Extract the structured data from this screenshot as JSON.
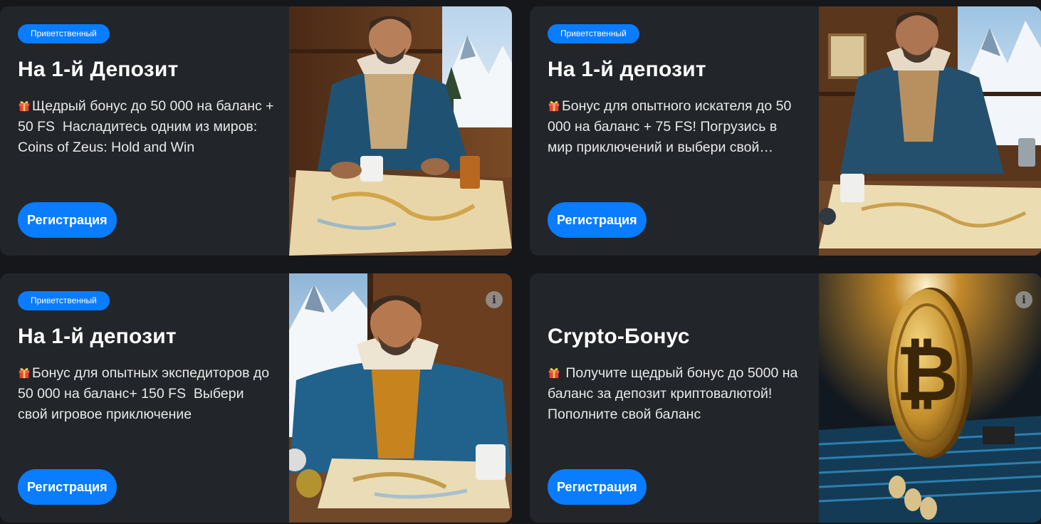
{
  "cards": [
    {
      "badge": "Приветственный",
      "title": "На 1-й Депозит",
      "description": "Щедрый бонус до 50 000 на баланс + 50 FS  Насладитесь одним из миров: Coins of Zeus: Hold and Win",
      "cta": "Регистрация",
      "image": "explorer-map-cabin",
      "has_info": false
    },
    {
      "badge": "Приветственный",
      "title": "На 1-й депозит",
      "description": "Бонус для опытного искателя до 50 000 на баланс + 75 FS! Погрузись в мир приключений и выбери свой игровой мир",
      "cta": "Регистрация",
      "image": "explorer-map-window",
      "has_info": false
    },
    {
      "badge": "Приветственный",
      "title": "На 1-й депозит",
      "description": "Бонус для опытных экспедиторов до 50 000 на баланс+ 150 FS  Выбери свой игровое приключение",
      "cta": "Регистрация",
      "image": "explorer-map-mountains",
      "has_info": true
    },
    {
      "badge": "",
      "title": "Crypto-Бонус",
      "description": " Получите щедрый бонус до 5000 на баланс за депозит криптовалютой! Пополните свой баланс",
      "cta": "Регистрация",
      "image": "bitcoin-coin",
      "has_info": true
    }
  ],
  "icons": {
    "gift": "gift-icon",
    "info": "info-icon"
  },
  "colors": {
    "accent": "#0a7cff",
    "card_bg": "#222529",
    "page_bg": "#15171b"
  }
}
